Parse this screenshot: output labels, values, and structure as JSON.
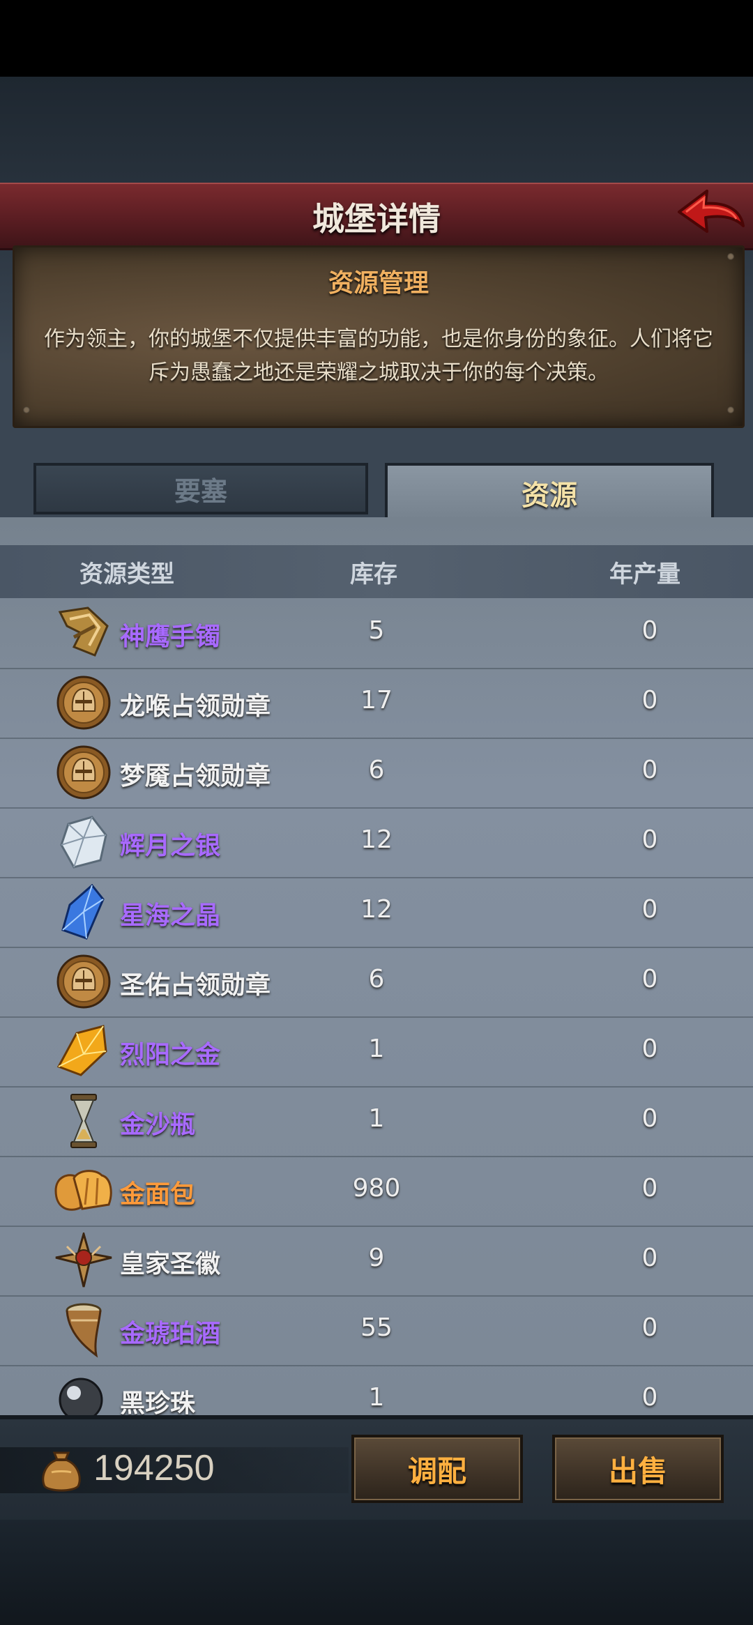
{
  "header": {
    "title": "城堡详情"
  },
  "info": {
    "title": "资源管理",
    "text": "作为领主，你的城堡不仅提供丰富的功能，也是你身份的象征。人们将它斥为愚蠢之地还是荣耀之城取决于你的每个决策。"
  },
  "tabs": [
    {
      "label": "要塞",
      "active": false
    },
    {
      "label": "资源",
      "active": true
    }
  ],
  "table": {
    "headers": {
      "type": "资源类型",
      "stock": "库存",
      "annual": "年产量"
    },
    "rows": [
      {
        "name": "神鹰手镯",
        "stock": "5",
        "annual": "0",
        "color": "#a86aff",
        "icon": "bracelet-icon"
      },
      {
        "name": "龙喉占领勋章",
        "stock": "17",
        "annual": "0",
        "color": "#f2f2f2",
        "icon": "medal-icon"
      },
      {
        "name": "梦魇占领勋章",
        "stock": "6",
        "annual": "0",
        "color": "#f2f2f2",
        "icon": "medal-icon"
      },
      {
        "name": "辉月之银",
        "stock": "12",
        "annual": "0",
        "color": "#a86aff",
        "icon": "silver-crystal-icon"
      },
      {
        "name": "星海之晶",
        "stock": "12",
        "annual": "0",
        "color": "#a86aff",
        "icon": "blue-crystal-icon"
      },
      {
        "name": "圣佑占领勋章",
        "stock": "6",
        "annual": "0",
        "color": "#f2f2f2",
        "icon": "medal-icon"
      },
      {
        "name": "烈阳之金",
        "stock": "1",
        "annual": "0",
        "color": "#a86aff",
        "icon": "gold-crystal-icon"
      },
      {
        "name": "金沙瓶",
        "stock": "1",
        "annual": "0",
        "color": "#a86aff",
        "icon": "hourglass-icon"
      },
      {
        "name": "金面包",
        "stock": "980",
        "annual": "0",
        "color": "#ff9a3a",
        "icon": "bread-icon"
      },
      {
        "name": "皇家圣徽",
        "stock": "9",
        "annual": "0",
        "color": "#f2f2f2",
        "icon": "emblem-icon"
      },
      {
        "name": "金琥珀酒",
        "stock": "55",
        "annual": "0",
        "color": "#a86aff",
        "icon": "horn-icon"
      },
      {
        "name": "黑珍珠",
        "stock": "1",
        "annual": "0",
        "color": "#f2f2f2",
        "icon": "pearl-icon"
      }
    ]
  },
  "footer": {
    "gold": "194250",
    "gold_icon": "gold-sack-icon",
    "allocate_label": "调配",
    "sell_label": "出售"
  }
}
